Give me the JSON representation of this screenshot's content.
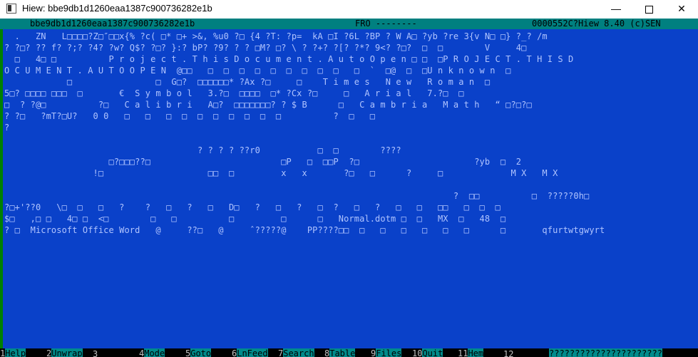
{
  "window": {
    "title": "Hiew: bbe9db1d1260eaa1387c900736282e1b",
    "minimize_glyph": "—",
    "close_glyph": "✕"
  },
  "status": {
    "filename": "bbe9db1d1260eaa1387c900736282e1b",
    "mode": "FRO --------",
    "offset_info": "0000552C?Hiew 8.40 (c)SEN"
  },
  "dump_lines": [
    "  .   ZN   L□□□□?Z□″□□x{% ?c( □* □+ >&, %u0 ?□ {4 ?T: ?p=  kA □I ?6L ?BP ? W A□ ?yb ?re 3{v N□ □} ?_? /m",
    "? ?□? ?? f? ?;? ?4? ?w? Q$? ?□? }:? bP? ?9? ? ? □M? □? \\ ? ?+? ?[? ?*? 9<? ?□?  □  □        V     4□",
    "  □   4□ □          P r o j e c t . T h i s D o c u m e n t . A u t o O p e n □ □  □P R O J E C T . T H I S D",
    "O C U M E N T . A U T O O P E N  @□□   □  □  □  □  □  □  □  □  □   □  `  □@  □  □U n k n o w n  □",
    "            □                □  G□?  □□□□□□* ?Ax ?□     □    T i m e s   N e w   R o m a n  □",
    "5□? □□□□ □□□  □       €  S y m b o l   3.?□  □□□□  □* ?Cx ?□     □   A r i a l   7.?□  □",
    "□  ? ?@□          ?□   C a l i b r i   A□?  □□□□□□□? ? $ B      □   C a m b r i a   M a t h   “ □?□?□",
    "? ?□   ?mT?□U?   0 0   □   □   □  □  □  □  □  □  □  □          ?  □   □",
    "?",
    "",
    "                                     ? ? ? ? ??r0           □  □        ????",
    "                    □?□□□??□                         □P   □  □□P  ?□                      ?yb  □  2",
    "                 !□                    □□  □         x   x       ?□   □      ?     □             M X   M X",
    "",
    "                                                                                      ?  □□          □  ?????0h□",
    "?□+'??0   \\□  □   □   ?    ?   □   ?   □   D□   ?   □   ?   □  ?   □   ?   □   □   □□   □  □  □",
    "$□   ,□ □   4□ □  <□        □   □          □         □      □   Normal.dotm □  □   MX  □   48  □",
    "? □  Microsoft Office Word   @     ??□   @     ˆ?????@    PP????□□  □   □   □   □   □   □      □       qfurtwtgwyrt"
  ],
  "function_keys": [
    {
      "num": "1",
      "label": "Help  "
    },
    {
      "num": "2",
      "label": "Unwrap"
    },
    {
      "num": "3",
      "label": "      "
    },
    {
      "num": "4",
      "label": "Mode  "
    },
    {
      "num": "5",
      "label": "Goto  "
    },
    {
      "num": "6",
      "label": "LnFeed"
    },
    {
      "num": "7",
      "label": "Search"
    },
    {
      "num": "8",
      "label": "Table "
    },
    {
      "num": "9",
      "label": "Files "
    },
    {
      "num": "10",
      "label": "Quit  "
    },
    {
      "num": "11",
      "label": "Hem   "
    },
    {
      "num": "12",
      "label": "      "
    }
  ],
  "function_keys_tail": "??????????????????????",
  "colors": {
    "screen_bg": "#0a41c9",
    "text": "#b0c4ff",
    "statusbar_bg": "#008080",
    "fkey_bg": "#008b8b"
  }
}
